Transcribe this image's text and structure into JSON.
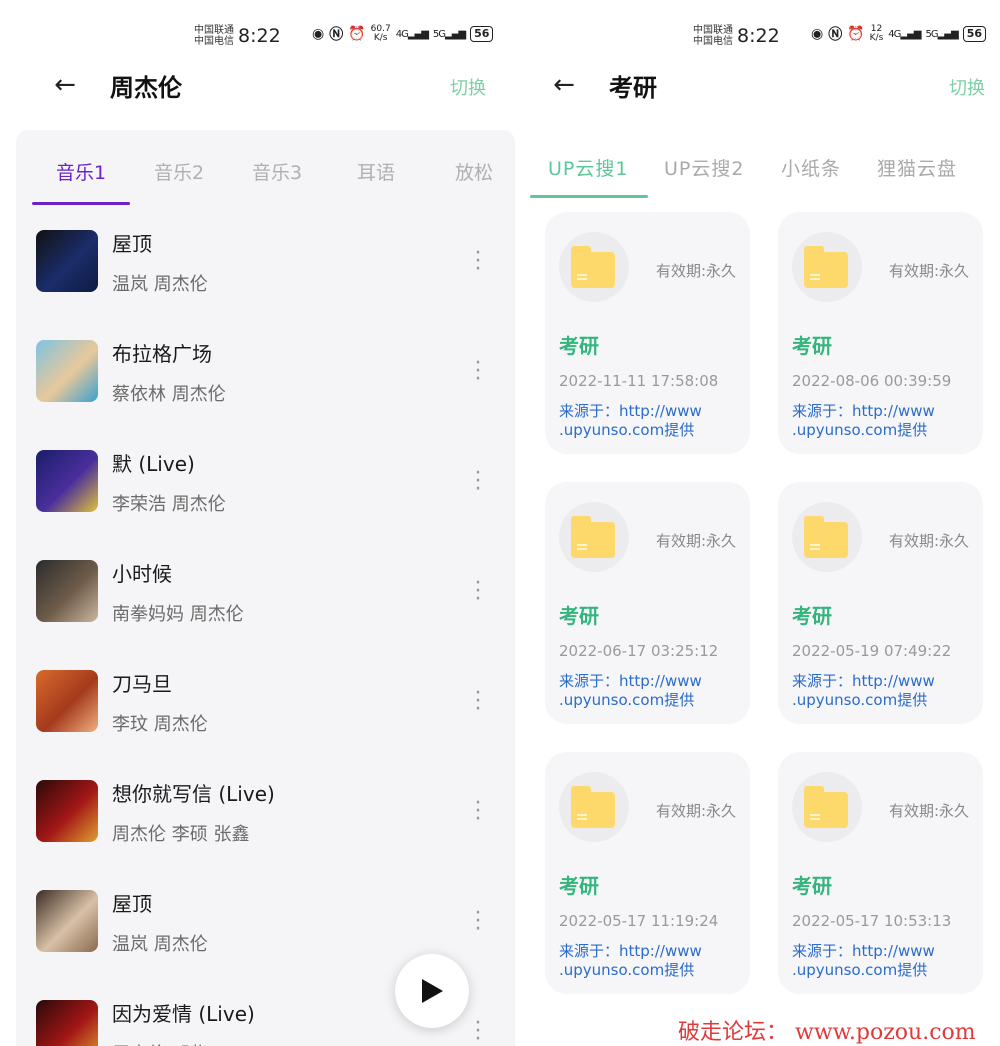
{
  "left": {
    "status": {
      "carrier1": "中国联通",
      "carrier2": "中国电信",
      "time": "8:22",
      "speed_value": "60.7",
      "speed_unit": "K/s",
      "net1": "4G",
      "net2": "5G",
      "battery": "56"
    },
    "header": {
      "back_icon": "back-arrow-icon",
      "title": "周杰伦",
      "switch_label": "切换"
    },
    "tabs": [
      "音乐1",
      "音乐2",
      "音乐3",
      "耳语",
      "放松"
    ],
    "active_tab": 0,
    "songs": [
      {
        "title": "屋顶",
        "artist": "温岚 周杰伦",
        "cover": [
          "#111",
          "#1b2d6b",
          "#0d1a40"
        ]
      },
      {
        "title": "布拉格广场",
        "artist": "蔡依林 周杰伦",
        "cover": [
          "#7ec3e2",
          "#e9c89a",
          "#3aa0d0"
        ]
      },
      {
        "title": "默 (Live)",
        "artist": "李荣浩 周杰伦",
        "cover": [
          "#1a1d6a",
          "#4a2f9c",
          "#e0c23a"
        ]
      },
      {
        "title": "小时候",
        "artist": "南拳妈妈 周杰伦",
        "cover": [
          "#2b2b2b",
          "#6e5c4a",
          "#c9b7a0"
        ]
      },
      {
        "title": "刀马旦",
        "artist": "李玟 周杰伦",
        "cover": [
          "#d96a2c",
          "#a43a1d",
          "#f0b080"
        ]
      },
      {
        "title": "想你就写信 (Live)",
        "artist": "周杰伦 李硕 张鑫",
        "cover": [
          "#2a0a0a",
          "#a31616",
          "#e0a030"
        ]
      },
      {
        "title": "屋顶",
        "artist": "温岚 周杰伦",
        "cover": [
          "#3a2c24",
          "#d8c0a6",
          "#8a6a50"
        ]
      },
      {
        "title": "因为爱情 (Live)",
        "artist": "周杰伦 邓紫",
        "cover": [
          "#2a0a0a",
          "#a31616",
          "#e0a030"
        ]
      }
    ],
    "play_icon": "play-icon"
  },
  "right": {
    "status": {
      "carrier1": "中国联通",
      "carrier2": "中国电信",
      "time": "8:22",
      "speed_value": "12",
      "speed_unit": "K/s",
      "net1": "4G",
      "net2": "5G",
      "battery": "56"
    },
    "header": {
      "back_icon": "back-arrow-icon",
      "title": "考研",
      "switch_label": "切换"
    },
    "tabs": [
      "UP云搜1",
      "UP云搜2",
      "小纸条",
      "狸猫云盘"
    ],
    "active_tab": 0,
    "cards": [
      {
        "validity": "有效期:永久",
        "title": "考研",
        "date": "2022-11-11 17:58:08",
        "source": "来源于：http://www .upyunso.com提供"
      },
      {
        "validity": "有效期:永久",
        "title": "考研",
        "date": "2022-08-06 00:39:59",
        "source": "来源于：http://www .upyunso.com提供"
      },
      {
        "validity": "有效期:永久",
        "title": "考研",
        "date": "2022-06-17 03:25:12",
        "source": "来源于：http://www .upyunso.com提供"
      },
      {
        "validity": "有效期:永久",
        "title": "考研",
        "date": "2022-05-19 07:49:22",
        "source": "来源于：http://www .upyunso.com提供"
      },
      {
        "validity": "有效期:永久",
        "title": "考研",
        "date": "2022-05-17 11:19:24",
        "source": "来源于：http://www .upyunso.com提供"
      },
      {
        "validity": "有效期:永久",
        "title": "考研",
        "date": "2022-05-17 10:53:13",
        "source": "来源于：http://www .upyunso.com提供"
      }
    ],
    "folder_icon": "folder-icon"
  },
  "watermark": "破走论坛： www.pozou.com",
  "colors": {
    "purple_accent": "#6c23c4",
    "green_accent": "#5ec79a",
    "switch_green": "#7dcfa6",
    "link_blue": "#2a6ccb",
    "watermark_red": "#e03b3b"
  }
}
